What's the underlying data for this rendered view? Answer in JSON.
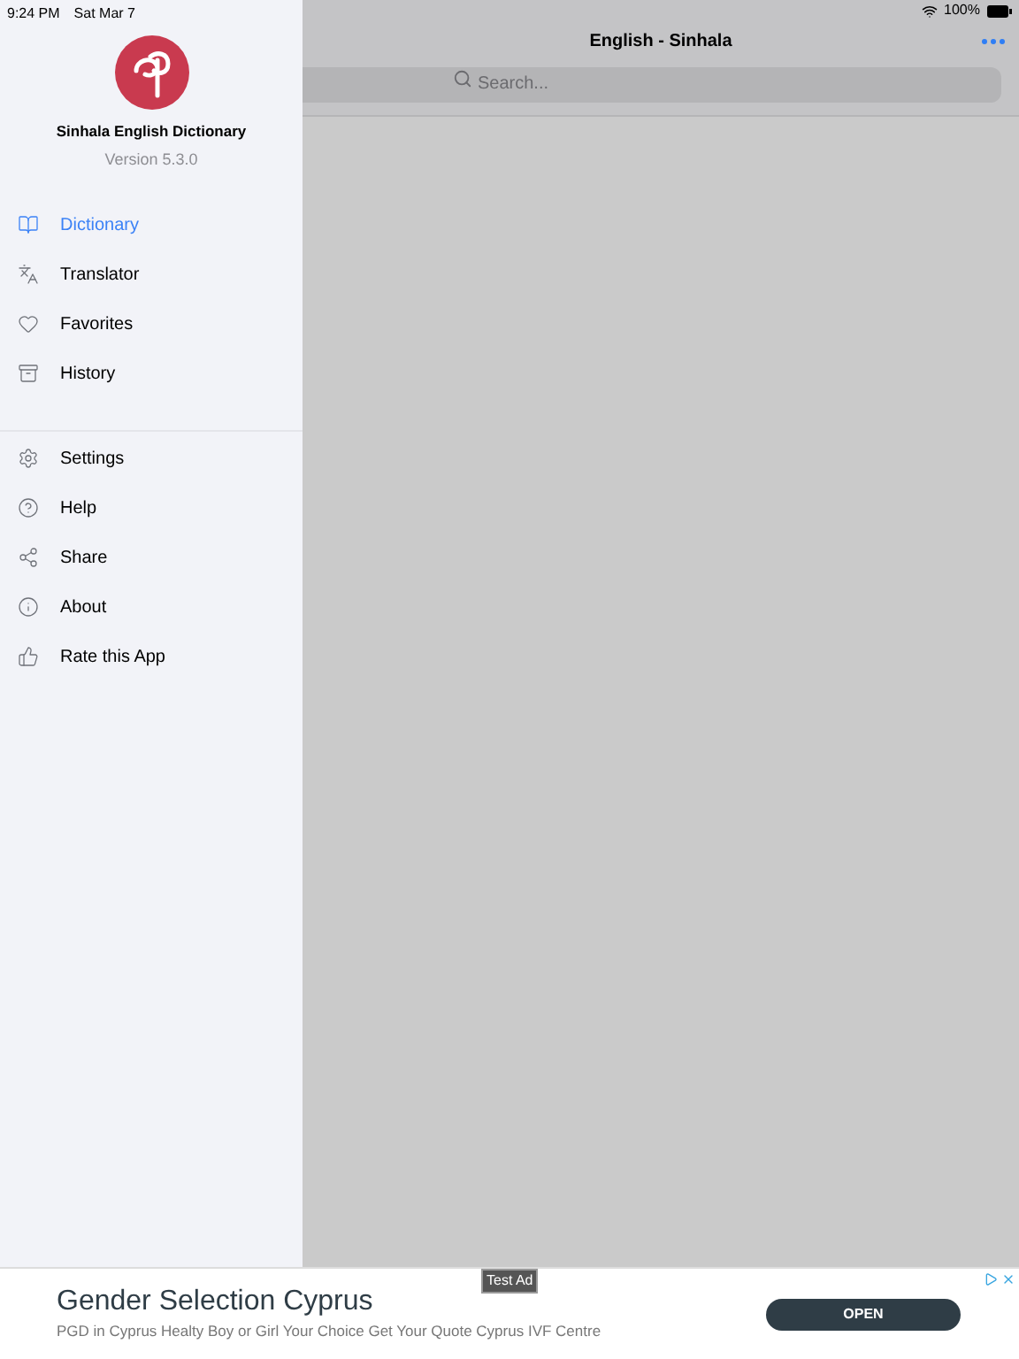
{
  "status_bar": {
    "time": "9:24 PM",
    "date": "Sat Mar 7",
    "battery": "100%"
  },
  "drawer": {
    "app_name": "Sinhala English Dictionary",
    "version": "Version 5.3.0",
    "sections": [
      [
        {
          "label": "Dictionary",
          "kind": "book",
          "selected": true
        },
        {
          "label": "Translator",
          "kind": "translate",
          "selected": false
        },
        {
          "label": "Favorites",
          "kind": "heart",
          "selected": false
        },
        {
          "label": "History",
          "kind": "archive",
          "selected": false
        }
      ],
      [
        {
          "label": "Settings",
          "kind": "gear",
          "selected": false
        },
        {
          "label": "Help",
          "kind": "help",
          "selected": false
        },
        {
          "label": "Share",
          "kind": "share",
          "selected": false
        },
        {
          "label": "About",
          "kind": "info",
          "selected": false
        },
        {
          "label": "Rate this App",
          "kind": "thumb",
          "selected": false
        }
      ]
    ]
  },
  "main": {
    "title": "English - Sinhala",
    "search": {
      "placeholder": "Search..."
    }
  },
  "ad": {
    "badge": "Test Ad",
    "headline": "Gender Selection Cyprus",
    "text": "PGD in Cyprus Healty Boy or Girl Your Choice Get Your Quote Cyprus IVF Centre",
    "button": "OPEN"
  }
}
